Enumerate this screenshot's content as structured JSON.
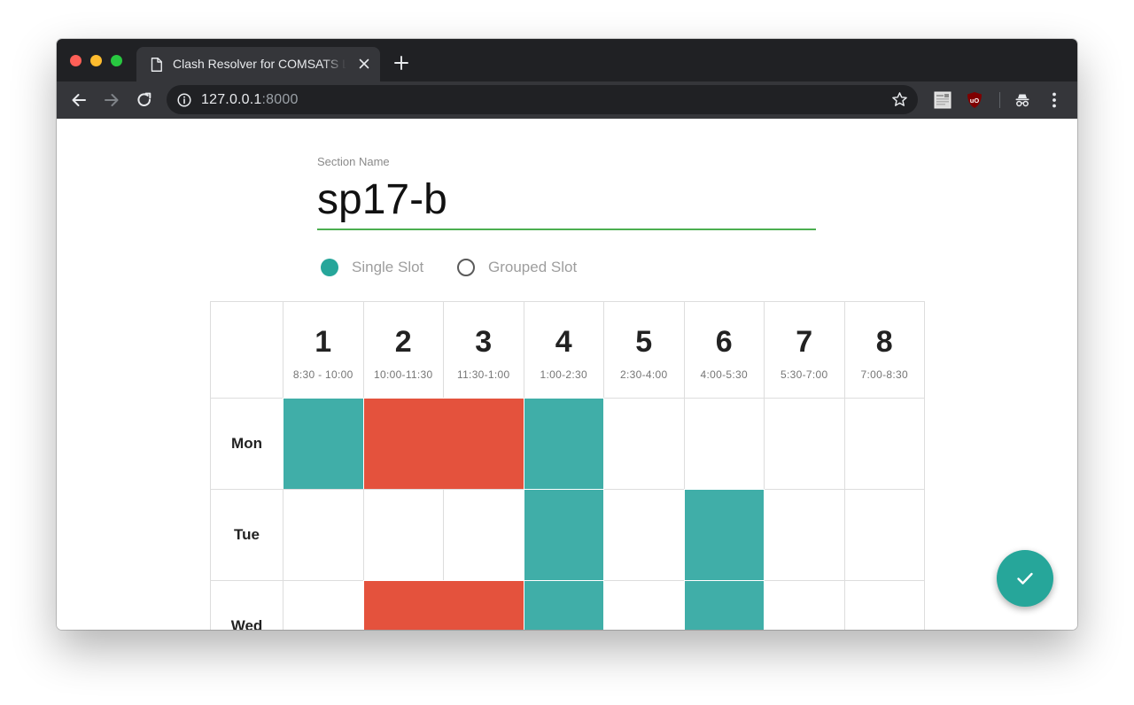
{
  "browser": {
    "tab_title": "Clash Resolver for COMSATS Lahore",
    "url_host": "127.0.0.1",
    "url_port": ":8000"
  },
  "form": {
    "section_label": "Section Name",
    "section_value": "sp17-b",
    "slot_modes": [
      {
        "label": "Single Slot",
        "selected": true
      },
      {
        "label": "Grouped Slot",
        "selected": false
      }
    ]
  },
  "timetable": {
    "periods": [
      {
        "num": "1",
        "time": "8:30 - 10:00"
      },
      {
        "num": "2",
        "time": "10:00-11:30"
      },
      {
        "num": "3",
        "time": "11:30-1:00"
      },
      {
        "num": "4",
        "time": "1:00-2:30"
      },
      {
        "num": "5",
        "time": "2:30-4:00"
      },
      {
        "num": "6",
        "time": "4:00-5:30"
      },
      {
        "num": "7",
        "time": "5:30-7:00"
      },
      {
        "num": "8",
        "time": "7:00-8:30"
      }
    ],
    "days": [
      {
        "label": "Mon",
        "slots": [
          {
            "period": 1,
            "span": 1,
            "type": "single"
          },
          {
            "period": 2,
            "span": 2,
            "type": "grouped"
          },
          {
            "period": 4,
            "span": 1,
            "type": "single"
          }
        ]
      },
      {
        "label": "Tue",
        "slots": [
          {
            "period": 4,
            "span": 1,
            "type": "single"
          },
          {
            "period": 6,
            "span": 1,
            "type": "single"
          }
        ]
      },
      {
        "label": "Wed",
        "slots": [
          {
            "period": 2,
            "span": 2,
            "type": "grouped"
          },
          {
            "period": 4,
            "span": 1,
            "type": "single"
          },
          {
            "period": 6,
            "span": 1,
            "type": "single"
          }
        ]
      }
    ]
  },
  "colors": {
    "single_slot": "#40aea8",
    "grouped_slot": "#e4523d",
    "input_underline": "#4caf50",
    "fab": "#26a69a"
  },
  "fab_icon": "check-icon"
}
